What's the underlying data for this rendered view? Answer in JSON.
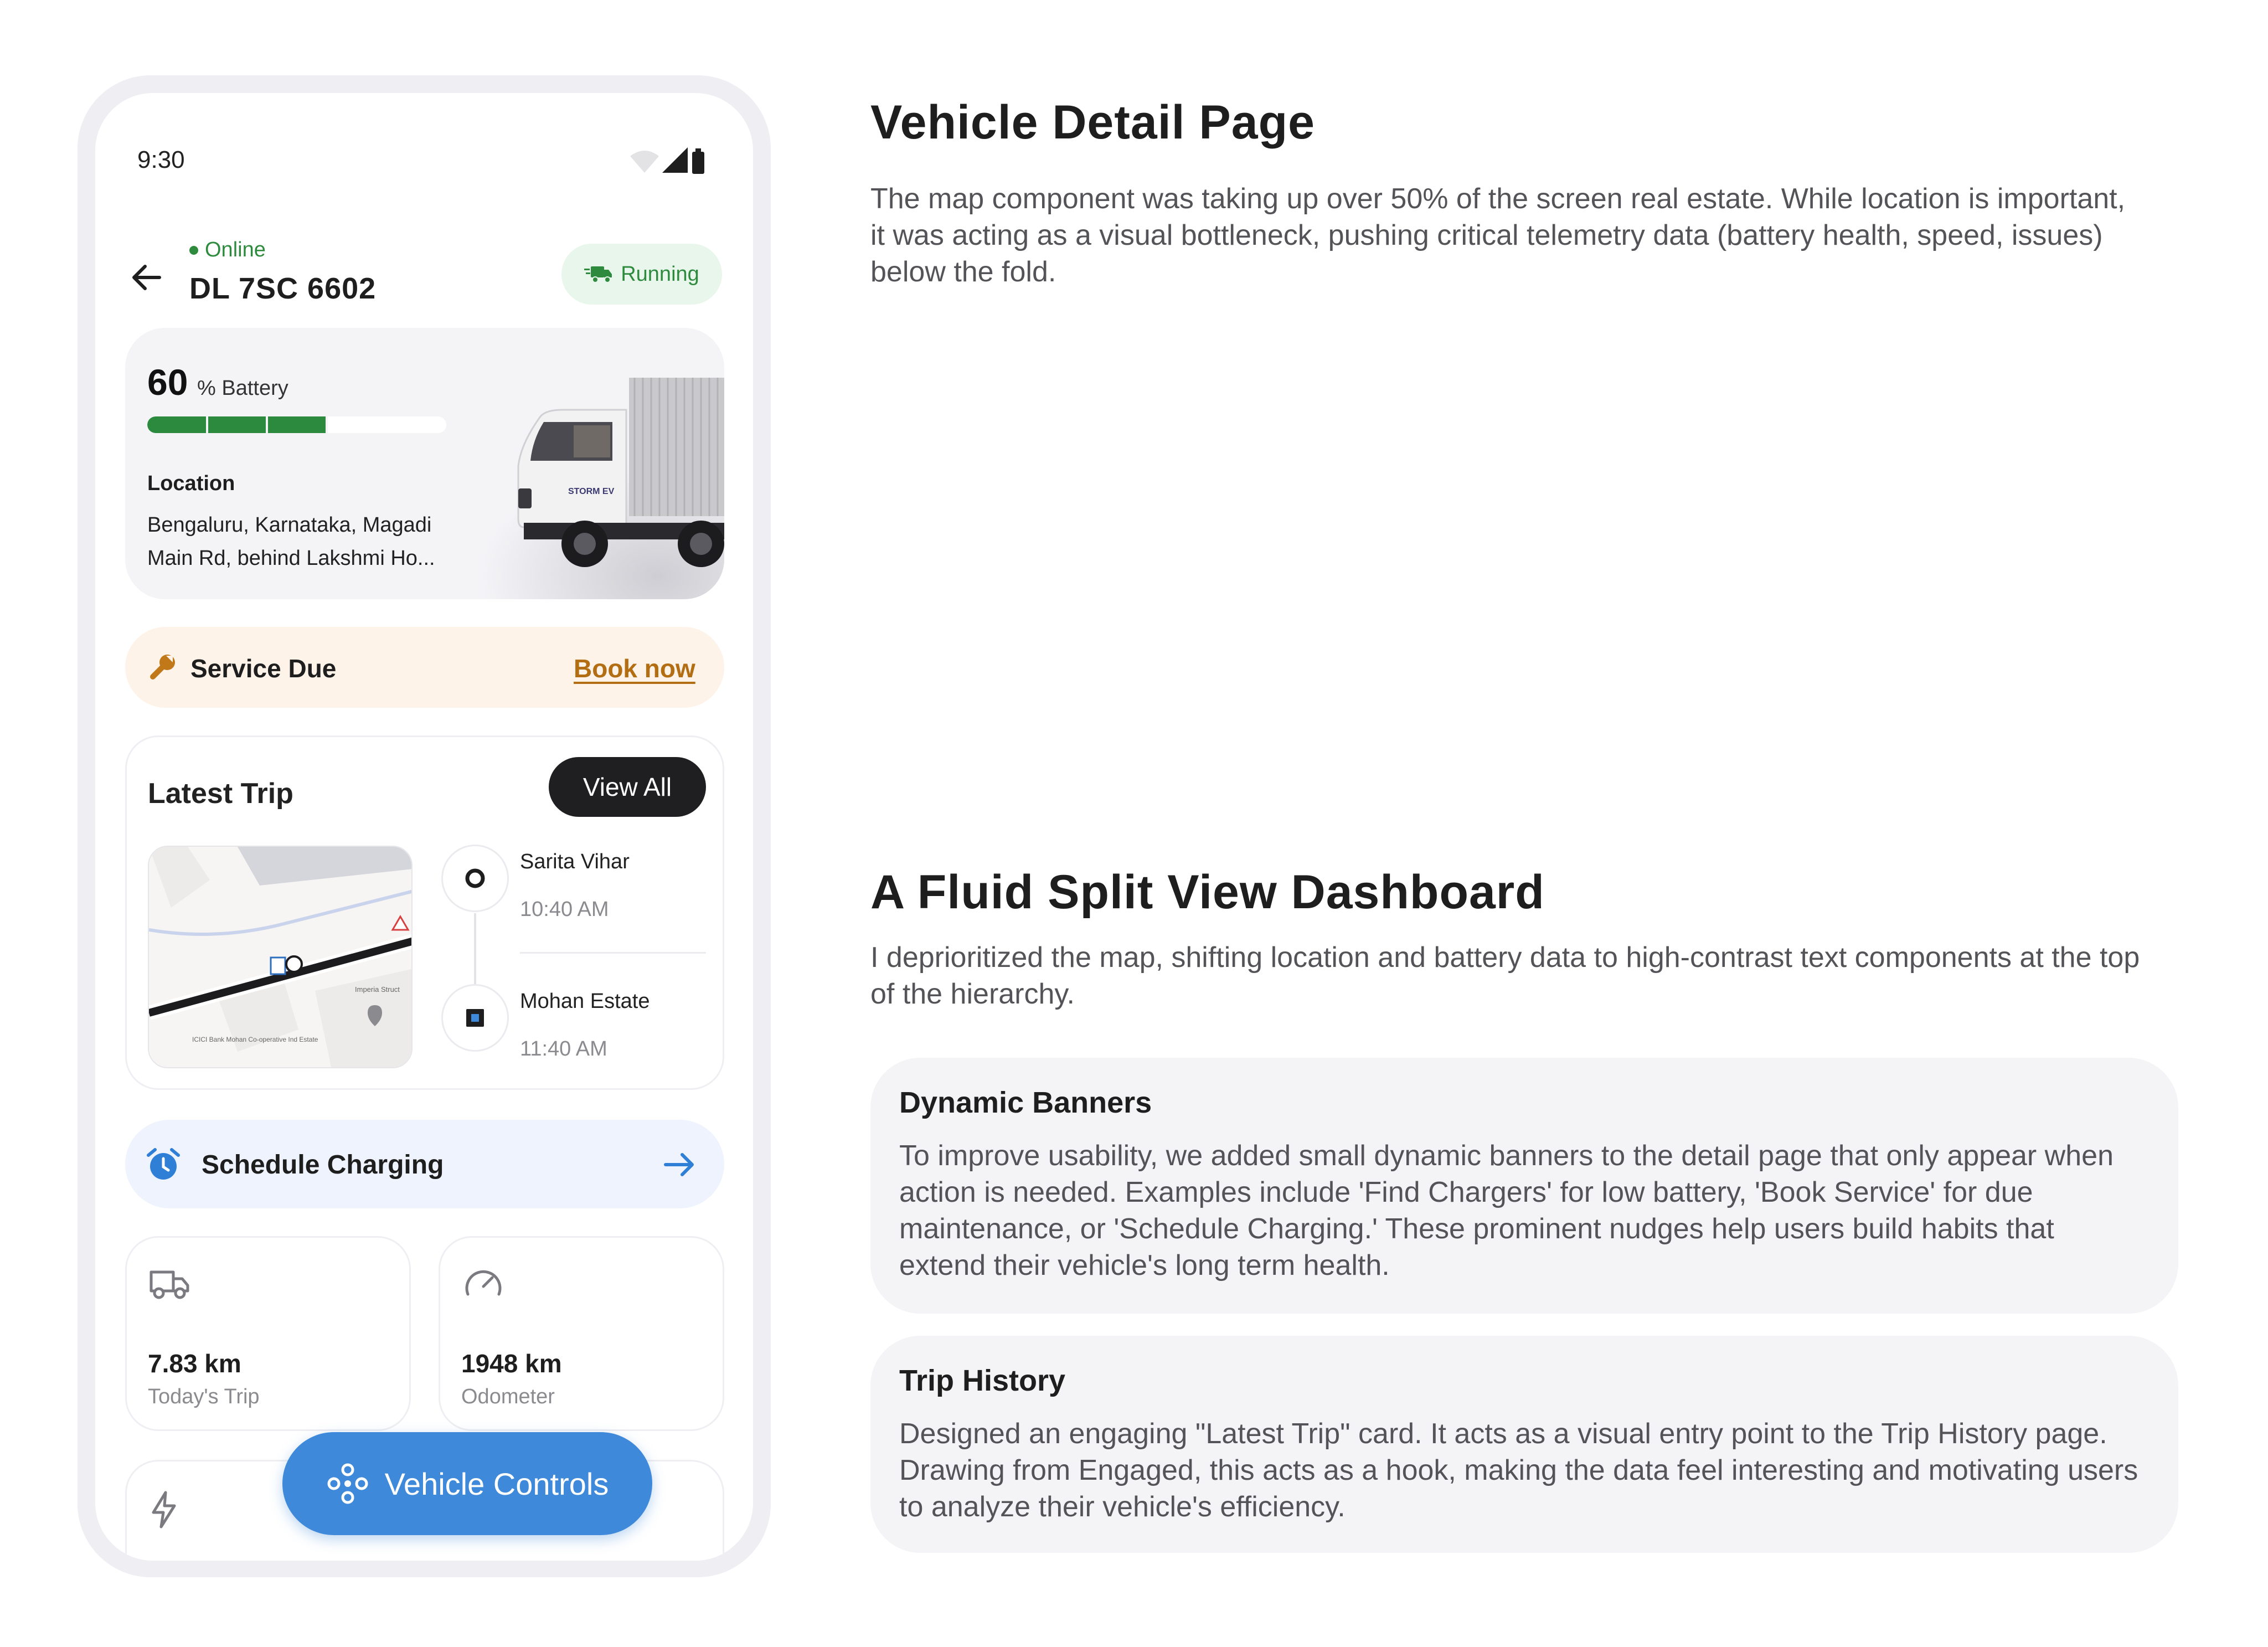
{
  "phone": {
    "status_bar": {
      "time": "9:30"
    },
    "header": {
      "status": "Online",
      "plate": "DL 7SC 6602",
      "badge": "Running"
    },
    "battery_card": {
      "battery_percent": "60",
      "battery_label": "% Battery",
      "battery_level": 0.6,
      "location_title": "Location",
      "location_text": "Bengaluru, Karnataka, Magadi Main Rd, behind Lakshmi Ho...",
      "truck_brand": "STORM EV"
    },
    "service_banner": {
      "label": "Service Due",
      "action": "Book now"
    },
    "latest_trip": {
      "title": "Latest Trip",
      "view_all": "View All",
      "map_labels": {
        "place1": "Imperia Struct",
        "place2": "ICICI Bank Mohan Co-operative Ind Estate"
      },
      "stops": [
        {
          "name": "Sarita Vihar",
          "time": "10:40 AM"
        },
        {
          "name": "Mohan Estate",
          "time": "11:40 AM"
        }
      ]
    },
    "schedule_charging": {
      "label": "Schedule Charging"
    },
    "stats": [
      {
        "icon": "truck-icon",
        "value": "7.83 km",
        "label": "Today's Trip"
      },
      {
        "icon": "speedometer-icon",
        "value": "1948 km",
        "label": "Odometer"
      }
    ],
    "fab": {
      "label": "Vehicle Controls"
    }
  },
  "description": {
    "section1": {
      "title": "Vehicle Detail Page",
      "body": "The map component was taking up over 50% of the screen real estate. While location is important, it was acting as a visual bottleneck, pushing critical telemetry data (battery health, speed, issues) below the fold."
    },
    "section2": {
      "title": "A Fluid Split View Dashboard",
      "body": "I deprioritized the map, shifting location and battery data to high-contrast text components at the top of the hierarchy."
    },
    "cards": [
      {
        "title": "Dynamic Banners",
        "body": "To improve usability, we added small dynamic banners to the detail page that only appear when action is needed. Examples include 'Find Chargers' for low battery, 'Book Service' for due maintenance, or 'Schedule Charging.' These prominent nudges help users build habits that extend their vehicle's long term health."
      },
      {
        "title": "Trip History",
        "body": "Designed an engaging \"Latest Trip\" card. It acts as a visual entry point to the Trip History page. Drawing from Engaged, this acts as a hook, making the data feel interesting and motivating users to analyze their vehicle's efficiency."
      }
    ]
  },
  "colors": {
    "online_green": "#2e8b3e",
    "battery_green": "#2b8a3e",
    "service_orange": "#b36d12",
    "fab_blue": "#3f89da",
    "arrow_blue": "#2f7fd6"
  }
}
